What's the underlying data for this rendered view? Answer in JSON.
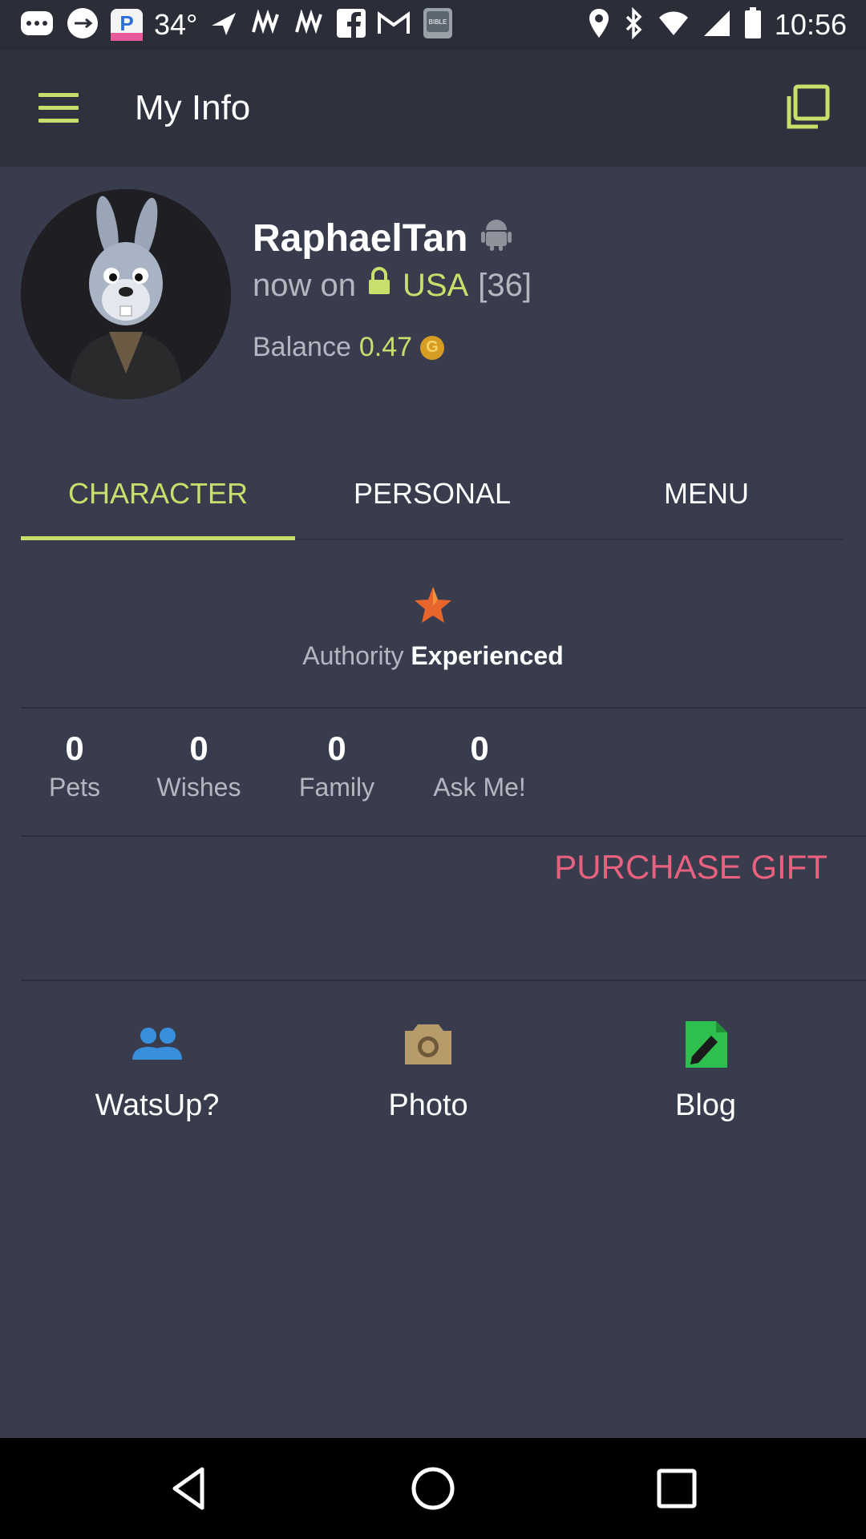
{
  "status_bar": {
    "temperature": "34°",
    "time": "10:56"
  },
  "app_bar": {
    "title": "My Info"
  },
  "profile": {
    "username": "RaphaelTan",
    "status_prefix": "now on",
    "country": "USA",
    "age": "[36]",
    "balance_label": "Balance",
    "balance_value": "0.47"
  },
  "tabs": [
    {
      "label": "CHARACTER"
    },
    {
      "label": "PERSONAL"
    },
    {
      "label": "MENU"
    }
  ],
  "authority": {
    "label": "Authority",
    "level": "Experienced"
  },
  "stats": [
    {
      "count": "0",
      "label": "Pets"
    },
    {
      "count": "0",
      "label": "Wishes"
    },
    {
      "count": "0",
      "label": "Family"
    },
    {
      "count": "0",
      "label": "Ask Me!"
    }
  ],
  "purchase_gift_label": "PURCHASE GIFT",
  "actions": [
    {
      "label": "WatsUp?",
      "icon": "people-icon",
      "color": "#3a8fdc"
    },
    {
      "label": "Photo",
      "icon": "camera-icon",
      "color": "#b89b6a"
    },
    {
      "label": "Blog",
      "icon": "edit-note-icon",
      "color": "#2fbf4f"
    }
  ],
  "colors": {
    "accent": "#c6e06b",
    "background": "#383c4c",
    "header": "#2f323e",
    "purchase": "#e8617e"
  }
}
